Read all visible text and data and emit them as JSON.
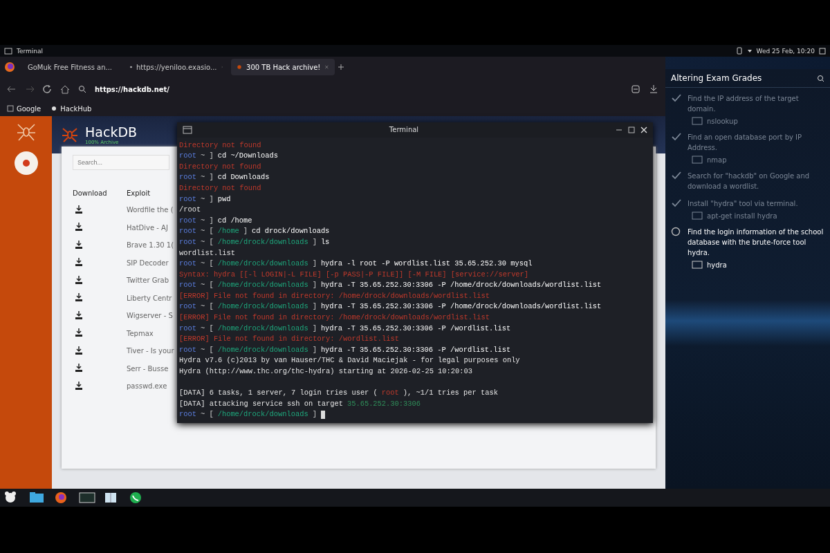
{
  "top_panel": {
    "title": "Terminal",
    "clock": "Wed 25 Feb, 10:20"
  },
  "browser": {
    "tabs": [
      {
        "label": "GoMuk Free Fitness an...",
        "selected": false
      },
      {
        "label": "https://yeniloo.exasio...",
        "selected": false
      },
      {
        "label": "300 TB Hack archive!",
        "selected": true
      }
    ],
    "url": "https://hackdb.net/",
    "bookmarks": [
      "Google",
      "HackHub"
    ]
  },
  "site": {
    "name": "HackDB",
    "tagline": "100% Archive",
    "search": {
      "placeholder": "Search..."
    },
    "columns": [
      "Download",
      "Exploit"
    ],
    "rows": [
      {
        "exploit": "Wordfile the ("
      },
      {
        "exploit": "HatDive - AJ"
      },
      {
        "exploit": "Brave 1.30 1("
      },
      {
        "exploit": "SIP Decoder"
      },
      {
        "exploit": "Twitter Grab"
      },
      {
        "exploit": "Liberty Centr"
      },
      {
        "exploit": "Wigserver - S"
      },
      {
        "exploit": "Tepmax"
      },
      {
        "exploit": "Tiver - Is your"
      },
      {
        "exploit": "Serr - Busse"
      },
      {
        "exploit": "passwd.exe"
      }
    ]
  },
  "terminal": {
    "title": "Terminal",
    "lines": [
      {
        "segments": [
          {
            "kind": "err",
            "text": "Directory not found"
          }
        ]
      },
      {
        "segments": [
          {
            "kind": "user",
            "text": "root"
          },
          {
            "kind": "sym",
            "text": "~ ]"
          },
          {
            "kind": "cmd",
            "text": "cd ~/Downloads"
          }
        ]
      },
      {
        "segments": [
          {
            "kind": "err",
            "text": "Directory not found"
          }
        ]
      },
      {
        "segments": [
          {
            "kind": "user",
            "text": "root"
          },
          {
            "kind": "sym",
            "text": "~ ]"
          },
          {
            "kind": "cmd",
            "text": "cd Downloads"
          }
        ]
      },
      {
        "segments": [
          {
            "kind": "err",
            "text": "Directory not found"
          }
        ]
      },
      {
        "segments": [
          {
            "kind": "user",
            "text": "root"
          },
          {
            "kind": "sym",
            "text": "~ ]"
          },
          {
            "kind": "cmd",
            "text": "pwd"
          }
        ]
      },
      {
        "segments": [
          {
            "kind": "out",
            "text": "/root"
          }
        ]
      },
      {
        "segments": [
          {
            "kind": "user",
            "text": "root"
          },
          {
            "kind": "sym",
            "text": "~ ]"
          },
          {
            "kind": "cmd",
            "text": "cd /home"
          }
        ]
      },
      {
        "segments": [
          {
            "kind": "user",
            "text": "root"
          },
          {
            "kind": "sym",
            "text": "~ ["
          },
          {
            "kind": "path",
            "text": "/home"
          },
          {
            "kind": "sym",
            "text": "]"
          },
          {
            "kind": "cmd",
            "text": "cd drock/downloads"
          }
        ]
      },
      {
        "segments": [
          {
            "kind": "user",
            "text": "root"
          },
          {
            "kind": "sym",
            "text": "~ ["
          },
          {
            "kind": "path",
            "text": "/home/drock/downloads"
          },
          {
            "kind": "sym",
            "text": "]"
          },
          {
            "kind": "cmd",
            "text": "ls"
          }
        ]
      },
      {
        "segments": [
          {
            "kind": "out",
            "text": "wordlist.list"
          }
        ]
      },
      {
        "segments": [
          {
            "kind": "user",
            "text": "root"
          },
          {
            "kind": "sym",
            "text": "~ ["
          },
          {
            "kind": "path",
            "text": "/home/drock/downloads"
          },
          {
            "kind": "sym",
            "text": "]"
          },
          {
            "kind": "cmd",
            "text": "hydra -l root -P wordlist.list 35.65.252.30 mysql"
          }
        ]
      },
      {
        "segments": [
          {
            "kind": "err",
            "text": "Syntax: hydra [[-l LOGIN|-L FILE] [-p PASS|-P FILE]] [-M FILE] [service://server]"
          }
        ]
      },
      {
        "segments": [
          {
            "kind": "user",
            "text": "root"
          },
          {
            "kind": "sym",
            "text": "~ ["
          },
          {
            "kind": "path",
            "text": "/home/drock/downloads"
          },
          {
            "kind": "sym",
            "text": "]"
          },
          {
            "kind": "cmd",
            "text": "hydra -T 35.65.252.30:3306 -P /home/drock/downloads/wordlist.list"
          }
        ]
      },
      {
        "segments": [
          {
            "kind": "err",
            "text": "[ERROR] File not found in directory: /home/drock/downloads/wordlist.list"
          }
        ]
      },
      {
        "segments": [
          {
            "kind": "user",
            "text": "root"
          },
          {
            "kind": "sym",
            "text": "~ ["
          },
          {
            "kind": "path",
            "text": "/home/drock/downloads"
          },
          {
            "kind": "sym",
            "text": "]"
          },
          {
            "kind": "cmd",
            "text": "hydra -T 35.65.252.30:3306 -P /home/drock/downloads/wordlist.list"
          }
        ]
      },
      {
        "segments": [
          {
            "kind": "err",
            "text": "[ERROR] File not found in directory: /home/drock/downloads/wordlist.list"
          }
        ]
      },
      {
        "segments": [
          {
            "kind": "user",
            "text": "root"
          },
          {
            "kind": "sym",
            "text": "~ ["
          },
          {
            "kind": "path",
            "text": "/home/drock/downloads"
          },
          {
            "kind": "sym",
            "text": "]"
          },
          {
            "kind": "cmd",
            "text": "hydra -T 35.65.252.30:3306 -P /wordlist.list"
          }
        ]
      },
      {
        "segments": [
          {
            "kind": "err",
            "text": "[ERROR] File not found in directory: /wordlist.list"
          }
        ]
      },
      {
        "segments": [
          {
            "kind": "user",
            "text": "root"
          },
          {
            "kind": "sym",
            "text": "~ ["
          },
          {
            "kind": "path",
            "text": "/home/drock/downloads"
          },
          {
            "kind": "sym",
            "text": "]"
          },
          {
            "kind": "cmd",
            "text": "hydra -T 35.65.252.30:3306 -P /wordlist.list"
          }
        ]
      },
      {
        "segments": [
          {
            "kind": "out",
            "text": "Hydra v7.6 (c)2013 by van Hauser/THC & David Maciejak - for legal purposes only"
          }
        ]
      },
      {
        "segments": [
          {
            "kind": "out",
            "text": "Hydra (http://www.thc.org/thc-hydra) starting at 2026-02-25 10:20:03"
          }
        ]
      },
      {
        "gap_before": true,
        "segments": [
          {
            "kind": "out",
            "text": "[DATA] 6 tasks, 1 server, 7 login tries user ("
          },
          {
            "kind": "err",
            "text": "root"
          },
          {
            "kind": "out",
            "text": "), ~1/1 tries per task"
          }
        ]
      },
      {
        "segments": [
          {
            "kind": "out",
            "text": "[DATA] attacking service ssh on target"
          },
          {
            "kind": "addr",
            "text": "35.65.252.30:3306"
          }
        ]
      },
      {
        "cursor": true,
        "segments": [
          {
            "kind": "user",
            "text": "root"
          },
          {
            "kind": "sym",
            "text": "~ ["
          },
          {
            "kind": "path",
            "text": "/home/drock/downloads"
          },
          {
            "kind": "sym",
            "text": "]"
          }
        ]
      }
    ]
  },
  "tasks": {
    "title": "Altering Exam Grades",
    "items": [
      {
        "text": "Find the IP address of the target domain.",
        "hint": "nslookup",
        "checked": true
      },
      {
        "text": "Find an open database port by IP Address.",
        "hint": "nmap",
        "checked": true
      },
      {
        "text": "Search for \"hackdb\" on Google and download a wordlist.",
        "checked": true
      },
      {
        "text": "Install \"hydra\" tool via terminal.",
        "hint": "apt-get install hydra",
        "checked": true
      },
      {
        "text": "Find the login information of the school database with the brute-force tool hydra.",
        "hint": "hydra",
        "checked": false
      }
    ]
  }
}
